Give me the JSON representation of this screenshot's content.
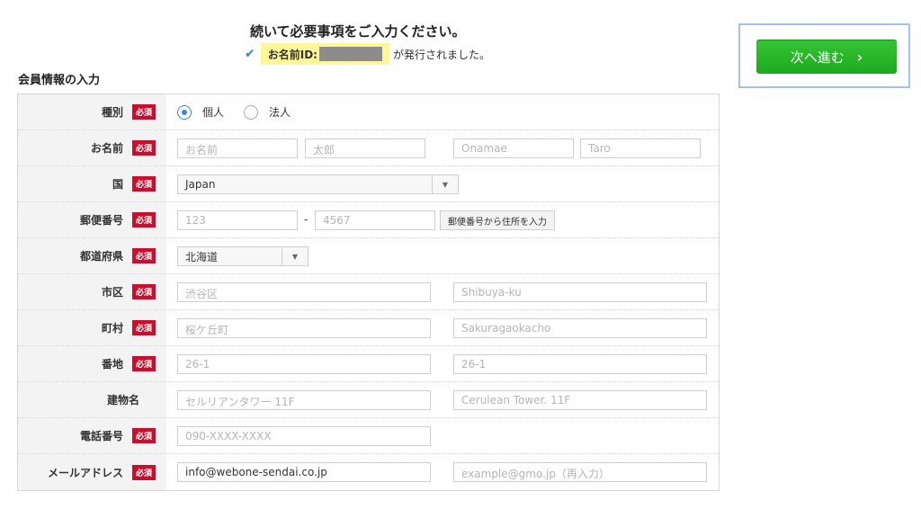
{
  "header": {
    "title": "続いて必要事項をご入力ください。",
    "id_label": "お名前ID:",
    "issued_text": "が発行されました。"
  },
  "next_button": {
    "label": "次へ進む",
    "chevron": "›"
  },
  "section": {
    "title": "会員情報の入力"
  },
  "required_badge": "必須",
  "form": {
    "type": {
      "label": "種別",
      "options": [
        {
          "label": "個人",
          "selected": true
        },
        {
          "label": "法人",
          "selected": false
        }
      ]
    },
    "name": {
      "label": "お名前",
      "last_kanji": "お名前",
      "first_kanji": "太郎",
      "last_roman": "Onamae",
      "first_roman": "Taro"
    },
    "country": {
      "label": "国",
      "value": "Japan"
    },
    "postal": {
      "label": "郵便番号",
      "part1": "123",
      "dash": "-",
      "part2": "4567",
      "lookup_button": "郵便番号から住所を入力"
    },
    "prefecture": {
      "label": "都道府県",
      "value": "北海道"
    },
    "city": {
      "label": "市区",
      "ja": "渋谷区",
      "en": "Shibuya-ku"
    },
    "town": {
      "label": "町村",
      "ja": "桜ケ丘町",
      "en": "Sakuragaokacho"
    },
    "block": {
      "label": "番地",
      "ja": "26-1",
      "en": "26-1"
    },
    "building": {
      "label": "建物名",
      "ja": "セルリアンタワー 11F",
      "en": "Cerulean Tower. 11F"
    },
    "phone": {
      "label": "電話番号",
      "placeholder": "090-XXXX-XXXX"
    },
    "email": {
      "label": "メールアドレス",
      "value": "info@webone-sendai.co.jp",
      "confirm_placeholder": "example@gmo.jp（再入力）"
    }
  },
  "colors": {
    "required_badge": "#c8102e",
    "next_button": "#1ea91e",
    "highlight": "#fff79a",
    "radio_selected": "#3b82d6"
  }
}
